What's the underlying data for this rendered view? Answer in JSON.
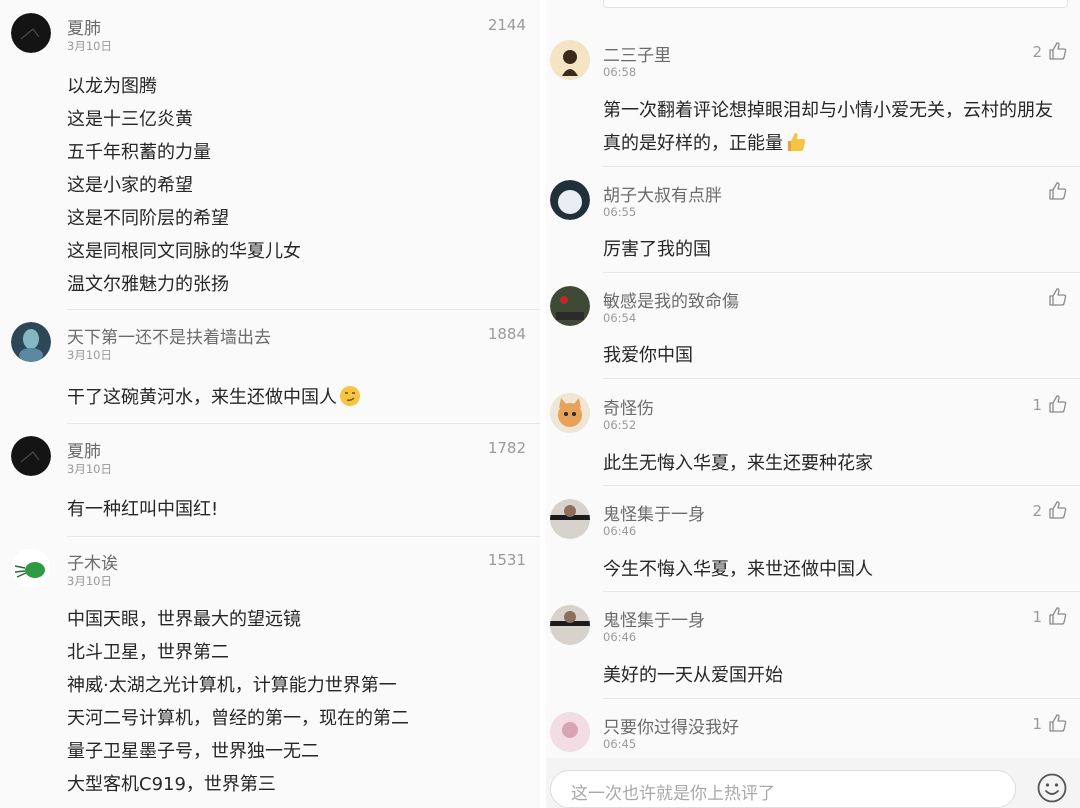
{
  "left": {
    "comments": [
      {
        "user": "夏肺",
        "time": "3月10日",
        "likes": "2144",
        "avatar_icon": "dark-avatar-icon",
        "lines": [
          "以龙为图腾",
          "这是十三亿炎黄",
          "五千年积蓄的力量",
          "这是小家的希望",
          "这是不同阶层的希望",
          "这是同根同文同脉的华夏儿女",
          "温文尔雅魅力的张扬"
        ]
      },
      {
        "user": "天下第一还不是扶着墙出去",
        "time": "3月10日",
        "likes": "1884",
        "avatar_icon": "blue-figure-avatar-icon",
        "lines": [
          "干了这碗黄河水，来生还做中国人"
        ],
        "emoji": "smirk-emoji-icon"
      },
      {
        "user": "夏肺",
        "time": "3月10日",
        "likes": "1782",
        "avatar_icon": "dark-avatar-icon",
        "lines": [
          "有一种红叫中国红!"
        ]
      },
      {
        "user": "子木诶",
        "time": "3月10日",
        "likes": "1531",
        "avatar_icon": "green-creature-avatar-icon",
        "lines": [
          "中国天眼，世界最大的望远镜",
          "北斗卫星，世界第二",
          "神威·太湖之光计算机，计算能力世界第一",
          "天河二号计算机，曾经的第一，现在的第二",
          "量子卫星墨子号，世界独一无二",
          "大型客机C919，世界第三"
        ]
      }
    ]
  },
  "right": {
    "comments": [
      {
        "user": "二三子里",
        "time": "06:58",
        "likes": "2",
        "avatar_icon": "cartoon-avatar-icon",
        "lines": [
          "第一次翻着评论想掉眼泪却与小情小爱无关，云村的朋友",
          "真的是好样的，正能量"
        ],
        "emoji": "thumbs-up-emoji-icon"
      },
      {
        "user": "胡子大叔有点胖",
        "time": "06:55",
        "likes": "",
        "avatar_icon": "white-cat-avatar-icon",
        "lines": [
          "厉害了我的国"
        ]
      },
      {
        "user": "敏感是我的致命傷",
        "time": "06:54",
        "likes": "",
        "avatar_icon": "flower-avatar-icon",
        "lines": [
          "我爱你中国"
        ]
      },
      {
        "user": "奇怪伤",
        "time": "06:52",
        "likes": "1",
        "avatar_icon": "kitten-avatar-icon",
        "lines": [
          "此生无悔入华夏，来生还要种花家"
        ]
      },
      {
        "user": "鬼怪集于一身",
        "time": "06:46",
        "likes": "2",
        "avatar_icon": "portrait-avatar-icon",
        "lines": [
          "今生不悔入华夏，来世还做中国人"
        ]
      },
      {
        "user": "鬼怪集于一身",
        "time": "06:46",
        "likes": "1",
        "avatar_icon": "portrait-avatar-icon",
        "lines": [
          "美好的一天从爱国开始"
        ]
      },
      {
        "user": "只要你过得没我好",
        "time": "06:45",
        "likes": "1",
        "avatar_icon": "pink-portrait-avatar-icon",
        "lines": []
      }
    ],
    "input": {
      "placeholder": "这一次也许就是你上热评了"
    }
  }
}
